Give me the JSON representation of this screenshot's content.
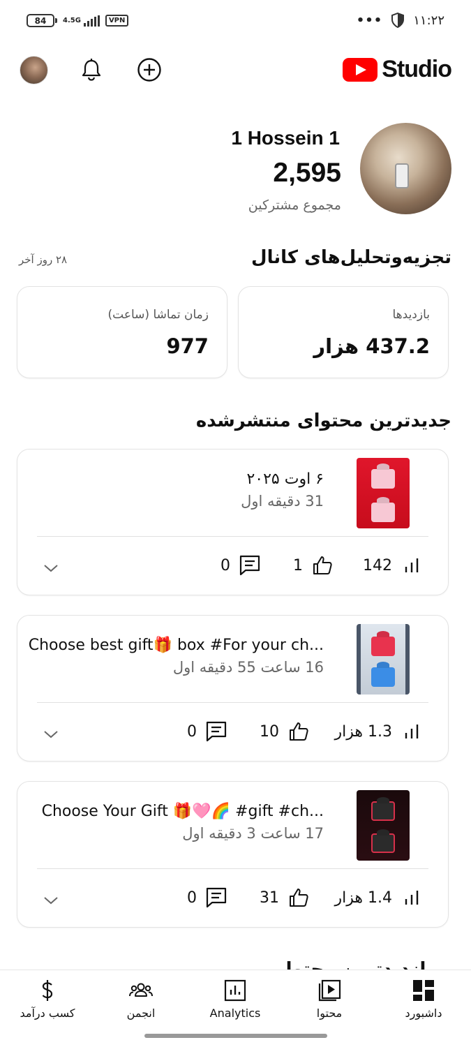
{
  "status_bar": {
    "battery": "84",
    "network": "4.5G",
    "vpn": "VPN",
    "dots": "•••",
    "time": "۱۱:۲۲"
  },
  "header": {
    "brand": "Studio",
    "icons": [
      "avatar",
      "bell-icon",
      "add-icon",
      "youtube-logo"
    ]
  },
  "channel": {
    "name": "1 Hossein 1",
    "subscribers": "2,595",
    "subscribers_label": "مجموع مشترکین"
  },
  "analytics": {
    "title": "تجزیه‌وتحلیل‌های کانال",
    "period": "۲۸ روز آخر",
    "views_label": "بازدیدها",
    "views_value": "437.2 هزار",
    "watch_label": "زمان تماشا (ساعت)",
    "watch_value": "977"
  },
  "latest": {
    "title": "جدیدترین محتوای منتشرشده",
    "videos": [
      {
        "title": "۶ اوت ۲۰۲۵",
        "subtitle": "31 دقیقه اول",
        "views": "142",
        "likes": "1",
        "comments": "0"
      },
      {
        "title": "Choose best gift🎁 box #For your ch...",
        "subtitle": "16 ساعت 55 دقیقه اول",
        "views": "1.3 هزار",
        "likes": "10",
        "comments": "0"
      },
      {
        "title": "Choose Your Gift 🎁🩷🌈 #gift #ch...",
        "subtitle": "17 ساعت 3 دقیقه اول",
        "views": "1.4 هزار",
        "likes": "31",
        "comments": "0"
      }
    ]
  },
  "partial_section_title": "پربازدیدترین محتوا",
  "bottom_nav": {
    "earn": "کسب درآمد",
    "community": "انجمن",
    "analytics": "Analytics",
    "content": "محتوا",
    "dashboard": "داشبورد"
  },
  "colors": {
    "brand_red": "#ff0000",
    "text_primary": "#0f0f0f",
    "text_secondary": "#666666",
    "card_border": "#e3e3e3"
  }
}
